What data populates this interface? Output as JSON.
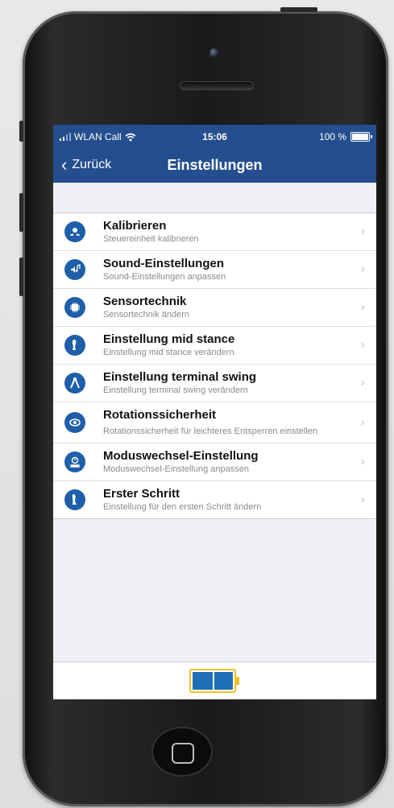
{
  "status": {
    "carrier": "WLAN Call",
    "time": "15:06",
    "battery": "100 %"
  },
  "nav": {
    "back_label": "Zurück",
    "title": "Einstellungen"
  },
  "items": [
    {
      "title": "Kalibrieren",
      "subtitle": "Steuereinheit kalibrieren",
      "icon": "calibrate-icon"
    },
    {
      "title": "Sound-Einstellungen",
      "subtitle": "Sound-Einstellungen anpassen",
      "icon": "sound-icon"
    },
    {
      "title": "Sensortechnik",
      "subtitle": "Sensortechnik ändern",
      "icon": "chip-icon"
    },
    {
      "title": "Einstellung mid stance",
      "subtitle": "Einstellung mid stance verändern",
      "icon": "leg-stance-icon"
    },
    {
      "title": "Einstellung terminal swing",
      "subtitle": "Einstellung terminal swing verändern",
      "icon": "swing-icon"
    },
    {
      "title": "Rotationssicherheit",
      "subtitle": "Rotationssicherheit für leichteres Entsperren einstellen",
      "icon": "rotation-icon"
    },
    {
      "title": "Moduswechsel-Einstellung",
      "subtitle": "Moduswechsel-Einstellung anpassen",
      "icon": "mode-switch-icon"
    },
    {
      "title": "Erster Schritt",
      "subtitle": "Einstellung für den ersten Schritt ändern",
      "icon": "first-step-icon"
    }
  ],
  "colors": {
    "nav_bg": "#244e8e",
    "icon_blue": "#1f5ea8",
    "battery_fill": "#1f6fb6"
  },
  "tabbar": {
    "icon": "battery-icon",
    "level": 0.5
  }
}
